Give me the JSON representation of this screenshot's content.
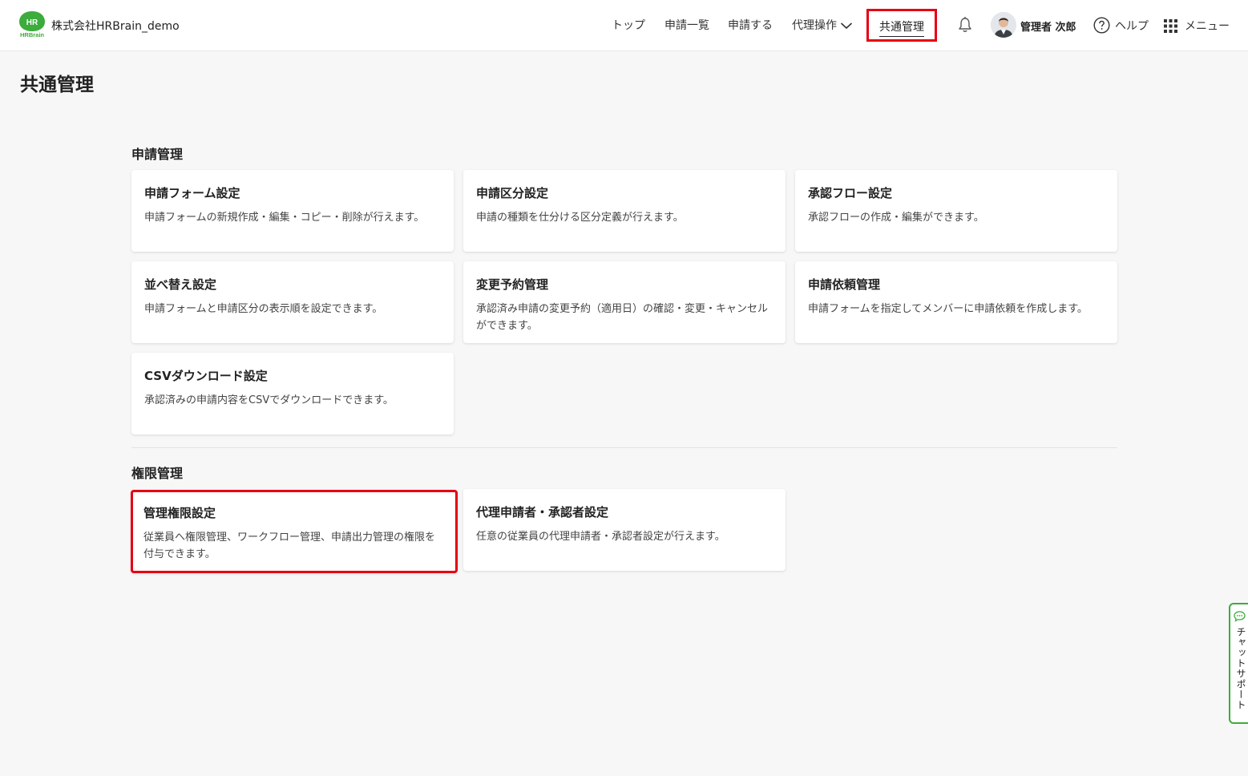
{
  "header": {
    "logo_text": "HR",
    "logo_sub": "HRBrain",
    "company": "株式会社HRBrain_demo",
    "nav": {
      "top": "トップ",
      "list": "申請一覧",
      "apply": "申請する",
      "proxy": "代理操作",
      "common": "共通管理"
    },
    "user_name": "管理者 次郎",
    "help": "ヘルプ",
    "menu": "メニュー"
  },
  "page": {
    "title": "共通管理"
  },
  "sections": [
    {
      "title": "申請管理",
      "cards": [
        {
          "title": "申請フォーム設定",
          "desc": "申請フォームの新規作成・編集・コピー・削除が行えます。"
        },
        {
          "title": "申請区分設定",
          "desc": "申請の種類を仕分ける区分定義が行えます。"
        },
        {
          "title": "承認フロー設定",
          "desc": "承認フローの作成・編集ができます。"
        },
        {
          "title": "並べ替え設定",
          "desc": "申請フォームと申請区分の表示順を設定できます。"
        },
        {
          "title": "変更予約管理",
          "desc": "承認済み申請の変更予約（適用日）の確認・変更・キャンセルができます。"
        },
        {
          "title": "申請依頼管理",
          "desc": "申請フォームを指定してメンバーに申請依頼を作成します。"
        },
        {
          "title": "CSVダウンロード設定",
          "desc": "承認済みの申請内容をCSVでダウンロードできます。"
        }
      ]
    },
    {
      "title": "権限管理",
      "cards": [
        {
          "title": "管理権限設定",
          "desc": "従業員へ権限管理、ワークフロー管理、申請出力管理の権限を付与できます。"
        },
        {
          "title": "代理申請者・承認者設定",
          "desc": "任意の従業員の代理申請者・承認者設定が行えます。"
        }
      ]
    }
  ],
  "chat_support": "チャットサポート",
  "colors": {
    "brand_green": "#3cac3c",
    "highlight_red": "#e60012"
  }
}
